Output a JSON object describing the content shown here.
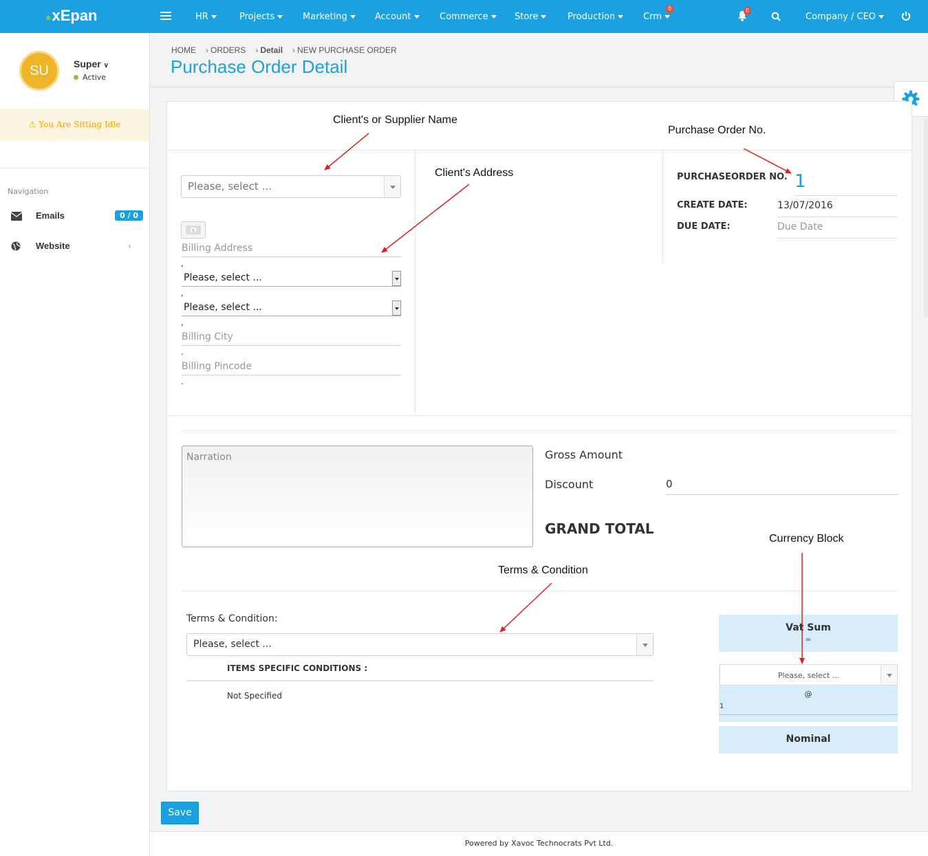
{
  "app": {
    "logo": "xEpan"
  },
  "topnav": {
    "items": [
      "HR",
      "Projects",
      "Marketing",
      "Account",
      "Commerce",
      "Store",
      "Production",
      "Crm"
    ],
    "crm_badge": "0",
    "bell_badge": "0",
    "user_menu": "Company / CEO"
  },
  "sidebar": {
    "avatar_initials": "SU",
    "user_name": "Super",
    "status": "Active",
    "idle_message": "You Are Sitting Idle",
    "nav_label": "Navigation",
    "items": [
      {
        "label": "Emails",
        "badge": "0 / 0"
      },
      {
        "label": "Website"
      }
    ]
  },
  "breadcrumb": [
    "HOME",
    "ORDERS",
    "Detail",
    "NEW PURCHASE ORDER"
  ],
  "page_title": "Purchase Order Detail",
  "client": {
    "select_placeholder": "Please, select ...",
    "billing_address": "Billing Address",
    "country_select": "Please, select ...",
    "state_select": "Please, select ...",
    "billing_city": "Billing City",
    "billing_pincode": "Billing Pincode",
    "separators": [
      ",",
      ",",
      ",",
      ".",
      "."
    ]
  },
  "po": {
    "number_label": "PURCHASEORDER NO.",
    "number_value": "1",
    "create_date_label": "CREATE DATE:",
    "create_date_value": "13/07/2016",
    "due_date_label": "DUE DATE:",
    "due_date_placeholder": "Due Date"
  },
  "amounts": {
    "narration_placeholder": "Narration",
    "gross_amount_label": "Gross Amount",
    "discount_label": "Discount",
    "discount_value": "0",
    "grand_total_label": "GRAND TOTAL"
  },
  "terms": {
    "label": "Terms & Condition:",
    "select_placeholder": "Please, select ...",
    "items_heading": "ITEMS SPECIFIC CONDITIONS :",
    "items_value": "Not Specified"
  },
  "currency": {
    "vat_sum_label": "Vat Sum",
    "equals": "=",
    "currency_select": "Please, select ...",
    "at": "@",
    "rate": "1",
    "nominal_label": "Nominal"
  },
  "annotations": {
    "client_name": "Client's or Supplier Name",
    "po_no": "Purchase Order No.",
    "client_address": "Client's Address",
    "terms": "Terms & Condition",
    "currency": "Currency Block"
  },
  "save_label": "Save",
  "footer": "Powered by Xavoc Technocrats Pvt Ltd.",
  "colors": {
    "primary": "#1ba1e2",
    "avatar": "#f0b429",
    "idle_text": "#f0a500",
    "currency_block": "#d9ecfa",
    "annotation_arrow": "#e02020"
  }
}
